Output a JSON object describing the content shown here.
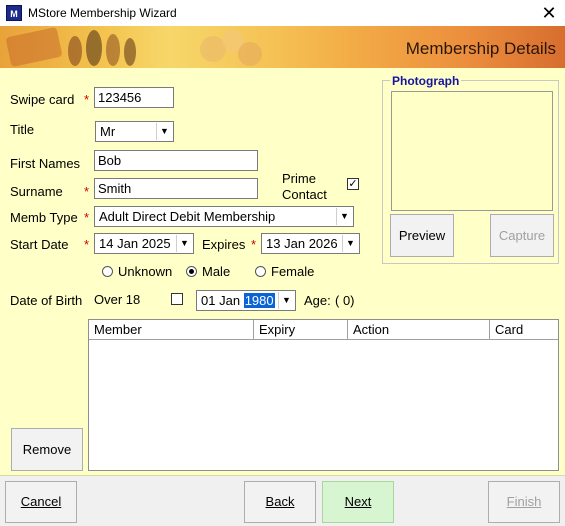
{
  "window": {
    "title": "MStore Membership Wizard",
    "icon_text": "M",
    "close_glyph": "✕"
  },
  "banner": {
    "title": "Membership Details"
  },
  "form": {
    "swipe_card": {
      "label": "Swipe card",
      "value": "123456"
    },
    "title": {
      "label": "Title",
      "value": "Mr"
    },
    "first_names": {
      "label": "First Names",
      "value": "Bob"
    },
    "surname": {
      "label": "Surname",
      "value": "Smith"
    },
    "prime_contact": {
      "label_line1": "Prime",
      "label_line2": "Contact",
      "checked": true
    },
    "memb_type": {
      "label": "Memb Type",
      "value": "Adult Direct Debit Membership"
    },
    "start_date": {
      "label": "Start Date",
      "day": "14",
      "month": "Jan",
      "year": "2025"
    },
    "expires": {
      "label": "Expires",
      "day": "13",
      "month": "Jan",
      "year": "2026"
    },
    "gender": {
      "options": [
        "Unknown",
        "Male",
        "Female"
      ],
      "selected": "Male"
    },
    "dob": {
      "label": "Date of Birth",
      "over18_label": "Over 18",
      "over18_checked": false,
      "day": "01",
      "month": "Jan",
      "year": "1980",
      "age_label": "Age:",
      "age_value": "( 0)"
    }
  },
  "photograph": {
    "legend": "Photograph",
    "preview_label": "Preview",
    "capture_label": "Capture"
  },
  "table": {
    "columns": [
      "Member",
      "Expiry",
      "Action",
      "Card"
    ]
  },
  "buttons": {
    "remove": "Remove",
    "cancel": "Cancel",
    "back": "Back",
    "next": "Next",
    "finish": "Finish"
  },
  "required_marker": "*",
  "colors": {
    "form_bg": "#ffffc8",
    "required": "#d00000",
    "legend": "#1515a0",
    "next_bg": "#d6f5d0"
  }
}
